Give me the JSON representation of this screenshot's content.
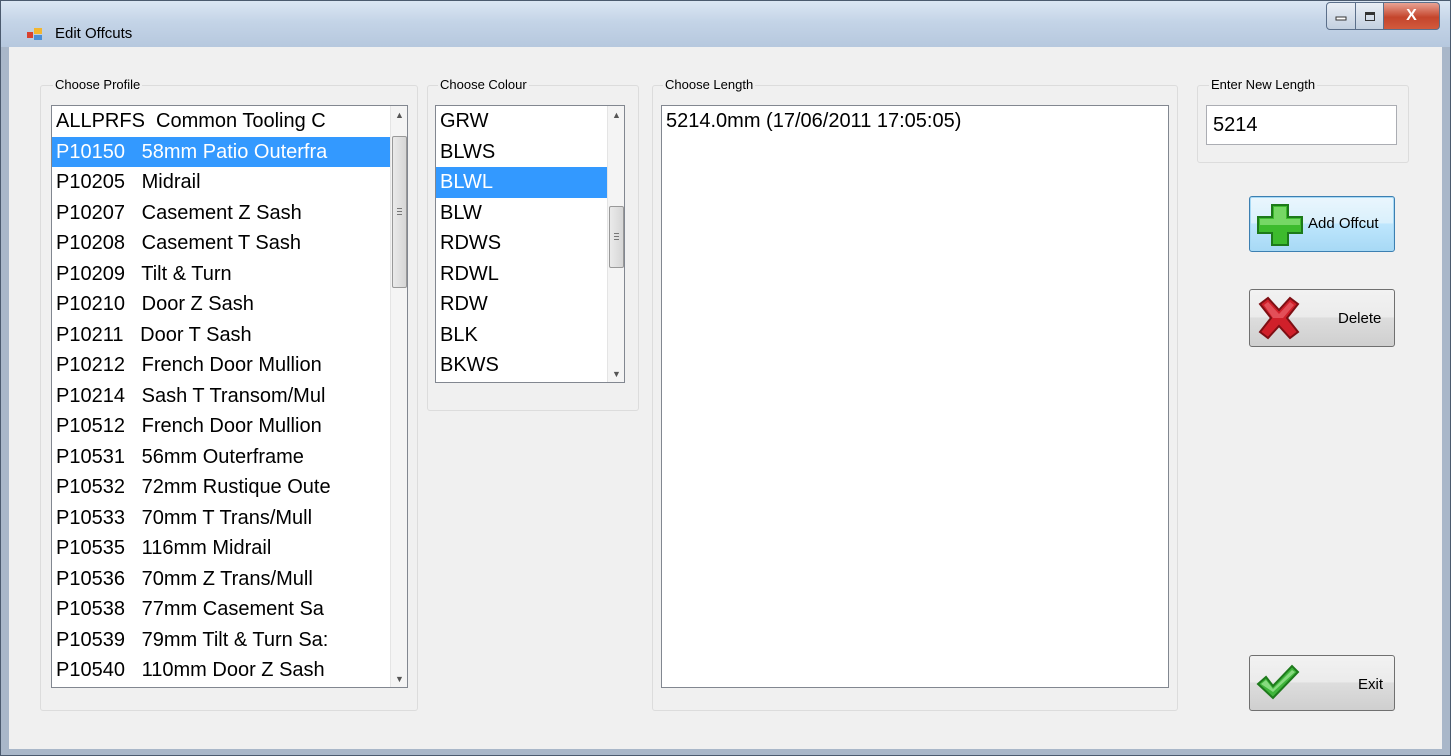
{
  "window": {
    "title": "Edit Offcuts",
    "controls": {
      "close": "X"
    }
  },
  "profile": {
    "label": "Choose Profile",
    "items": [
      "ALLPRFS  Common Tooling C",
      "P10150   58mm Patio Outerfra",
      "P10205   Midrail",
      "P10207   Casement Z Sash",
      "P10208   Casement T Sash",
      "P10209   Tilt & Turn",
      "P10210   Door Z Sash",
      "P10211   Door T Sash",
      "P10212   French Door Mullion",
      "P10214   Sash T Transom/Mul",
      "P10512   French Door Mullion",
      "P10531   56mm Outerframe",
      "P10532   72mm Rustique Oute",
      "P10533   70mm T Trans/Mull",
      "P10535   116mm Midrail",
      "P10536   70mm Z Trans/Mull",
      "P10538   77mm Casement Sa",
      "P10539   79mm Tilt & Turn Sa:",
      "P10540   110mm Door Z Sash"
    ],
    "selected_index": 1
  },
  "colour": {
    "label": "Choose Colour",
    "items": [
      "GRW",
      "BLWS",
      "BLWL",
      "BLW",
      "RDWS",
      "RDWL",
      "RDW",
      "BLK",
      "BKWS"
    ],
    "selected_index": 2
  },
  "length": {
    "label": "Choose Length",
    "items": [
      "5214.0mm (17/06/2011 17:05:05)"
    ]
  },
  "new_length": {
    "label": "Enter New Length",
    "value": "5214"
  },
  "buttons": {
    "add": "Add Offcut",
    "delete": "Delete",
    "exit": "Exit"
  },
  "colors": {
    "selection": "#3399ff",
    "add_icon": "#3dbb2d",
    "delete_icon": "#d0202a",
    "exit_icon": "#3fb53b"
  }
}
